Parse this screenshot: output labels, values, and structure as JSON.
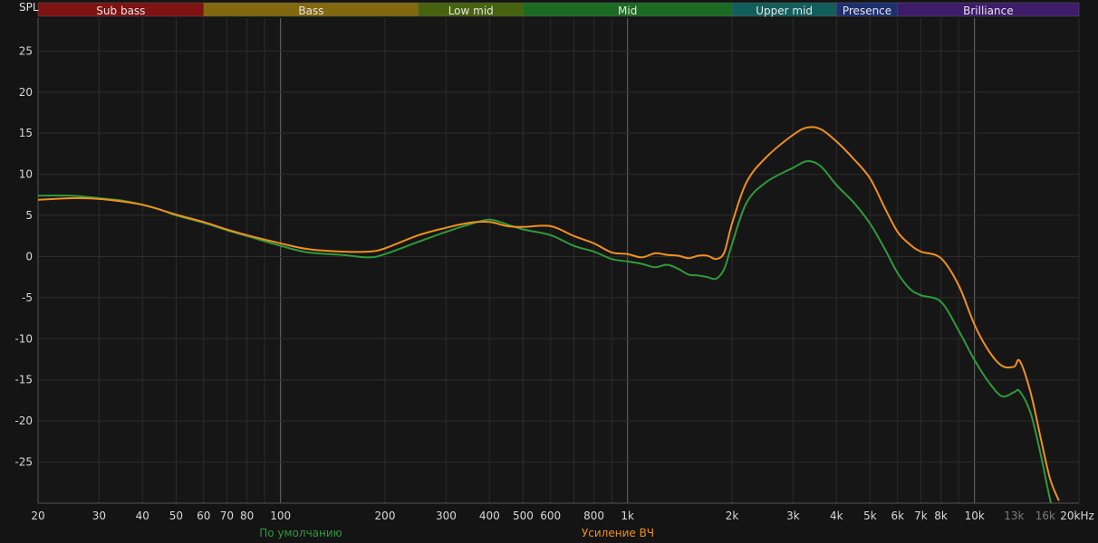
{
  "chart_data": {
    "type": "line",
    "ylabel": "SPL",
    "xunit": "Hz",
    "xscale": "log",
    "xlim": [
      20,
      20000
    ],
    "ylim": [
      -30,
      29
    ],
    "grid": true,
    "legend": "bottom",
    "bands": [
      {
        "name": "Sub bass",
        "from": 20,
        "to": 60,
        "color": "#7f1212"
      },
      {
        "name": "Bass",
        "from": 60,
        "to": 250,
        "color": "#82680e"
      },
      {
        "name": "Low mid",
        "from": 250,
        "to": 500,
        "color": "#47630f"
      },
      {
        "name": "Mid",
        "from": 500,
        "to": 2000,
        "color": "#1c6b22"
      },
      {
        "name": "Upper mid",
        "from": 2000,
        "to": 4000,
        "color": "#125e5b"
      },
      {
        "name": "Presence",
        "from": 4000,
        "to": 6000,
        "color": "#1e2f70"
      },
      {
        "name": "Brilliance",
        "from": 6000,
        "to": 20000,
        "color": "#3d1c6b"
      }
    ],
    "x_ticks": [
      {
        "v": 20,
        "label": "20"
      },
      {
        "v": 30,
        "label": "30"
      },
      {
        "v": 40,
        "label": "40"
      },
      {
        "v": 50,
        "label": "50"
      },
      {
        "v": 60,
        "label": "60"
      },
      {
        "v": 70,
        "label": "70"
      },
      {
        "v": 80,
        "label": "80"
      },
      {
        "v": 100,
        "label": "100"
      },
      {
        "v": 200,
        "label": "200"
      },
      {
        "v": 300,
        "label": "300"
      },
      {
        "v": 400,
        "label": "400"
      },
      {
        "v": 500,
        "label": "500"
      },
      {
        "v": 600,
        "label": "600"
      },
      {
        "v": 800,
        "label": "800"
      },
      {
        "v": 1000,
        "label": "1k"
      },
      {
        "v": 2000,
        "label": "2k"
      },
      {
        "v": 3000,
        "label": "3k"
      },
      {
        "v": 4000,
        "label": "4k"
      },
      {
        "v": 5000,
        "label": "5k"
      },
      {
        "v": 6000,
        "label": "6k"
      },
      {
        "v": 7000,
        "label": "7k"
      },
      {
        "v": 8000,
        "label": "8k"
      },
      {
        "v": 10000,
        "label": "10k"
      },
      {
        "v": 13000,
        "label": "13k",
        "dim": true
      },
      {
        "v": 16000,
        "label": "16k",
        "dim": true
      },
      {
        "v": 20000,
        "label": "20kHz"
      }
    ],
    "y_ticks": [
      25,
      20,
      15,
      10,
      5,
      0,
      -5,
      -10,
      -15,
      -20,
      -25
    ],
    "series": [
      {
        "name": "По умолчанию",
        "color": "#2f9a3a",
        "points": [
          [
            20,
            7.4
          ],
          [
            25,
            7.4
          ],
          [
            30,
            7.1
          ],
          [
            35,
            6.8
          ],
          [
            40,
            6.3
          ],
          [
            45,
            5.7
          ],
          [
            50,
            5.0
          ],
          [
            60,
            4.1
          ],
          [
            70,
            3.2
          ],
          [
            80,
            2.5
          ],
          [
            100,
            1.3
          ],
          [
            120,
            0.5
          ],
          [
            150,
            0.2
          ],
          [
            180,
            -0.1
          ],
          [
            200,
            0.3
          ],
          [
            250,
            1.8
          ],
          [
            300,
            3.0
          ],
          [
            350,
            3.9
          ],
          [
            400,
            4.5
          ],
          [
            450,
            3.9
          ],
          [
            500,
            3.3
          ],
          [
            600,
            2.6
          ],
          [
            700,
            1.3
          ],
          [
            800,
            0.6
          ],
          [
            900,
            -0.3
          ],
          [
            1000,
            -0.6
          ],
          [
            1100,
            -0.9
          ],
          [
            1200,
            -1.3
          ],
          [
            1300,
            -1.0
          ],
          [
            1400,
            -1.5
          ],
          [
            1500,
            -2.2
          ],
          [
            1600,
            -2.3
          ],
          [
            1700,
            -2.5
          ],
          [
            1800,
            -2.7
          ],
          [
            1900,
            -1.5
          ],
          [
            2000,
            1.5
          ],
          [
            2200,
            6.5
          ],
          [
            2500,
            9.0
          ],
          [
            3000,
            10.8
          ],
          [
            3300,
            11.6
          ],
          [
            3600,
            11.0
          ],
          [
            4000,
            8.7
          ],
          [
            4500,
            6.5
          ],
          [
            5000,
            4.0
          ],
          [
            5500,
            1.0
          ],
          [
            6000,
            -2.0
          ],
          [
            6500,
            -3.9
          ],
          [
            7000,
            -4.7
          ],
          [
            8000,
            -5.5
          ],
          [
            9000,
            -9.0
          ],
          [
            10000,
            -12.6
          ],
          [
            11000,
            -15.3
          ],
          [
            12000,
            -17.0
          ],
          [
            13000,
            -16.5
          ],
          [
            13500,
            -16.4
          ],
          [
            14500,
            -19.0
          ],
          [
            15500,
            -24.0
          ],
          [
            16500,
            -29.5
          ],
          [
            17000,
            -31.0
          ]
        ]
      },
      {
        "name": "Усиление ВЧ",
        "color": "#f0901e",
        "points": [
          [
            20,
            6.9
          ],
          [
            25,
            7.1
          ],
          [
            30,
            7.0
          ],
          [
            35,
            6.7
          ],
          [
            40,
            6.3
          ],
          [
            45,
            5.7
          ],
          [
            50,
            5.1
          ],
          [
            60,
            4.2
          ],
          [
            70,
            3.3
          ],
          [
            80,
            2.6
          ],
          [
            100,
            1.6
          ],
          [
            120,
            0.9
          ],
          [
            150,
            0.6
          ],
          [
            180,
            0.6
          ],
          [
            200,
            1.0
          ],
          [
            250,
            2.6
          ],
          [
            300,
            3.5
          ],
          [
            350,
            4.1
          ],
          [
            400,
            4.2
          ],
          [
            450,
            3.7
          ],
          [
            500,
            3.6
          ],
          [
            600,
            3.7
          ],
          [
            700,
            2.5
          ],
          [
            800,
            1.6
          ],
          [
            900,
            0.5
          ],
          [
            1000,
            0.3
          ],
          [
            1100,
            -0.1
          ],
          [
            1200,
            0.4
          ],
          [
            1300,
            0.2
          ],
          [
            1400,
            0.1
          ],
          [
            1500,
            -0.2
          ],
          [
            1600,
            0.1
          ],
          [
            1700,
            0.1
          ],
          [
            1800,
            -0.3
          ],
          [
            1900,
            0.5
          ],
          [
            2000,
            4.0
          ],
          [
            2200,
            9.0
          ],
          [
            2500,
            12.0
          ],
          [
            3000,
            14.8
          ],
          [
            3300,
            15.7
          ],
          [
            3600,
            15.5
          ],
          [
            4000,
            14.0
          ],
          [
            4500,
            11.8
          ],
          [
            5000,
            9.5
          ],
          [
            5500,
            6.0
          ],
          [
            6000,
            3.0
          ],
          [
            6500,
            1.5
          ],
          [
            7000,
            0.6
          ],
          [
            8000,
            -0.2
          ],
          [
            9000,
            -3.5
          ],
          [
            10000,
            -8.3
          ],
          [
            11000,
            -11.5
          ],
          [
            12000,
            -13.3
          ],
          [
            13000,
            -13.4
          ],
          [
            13500,
            -12.7
          ],
          [
            14500,
            -16.5
          ],
          [
            15500,
            -22.0
          ],
          [
            16500,
            -27.0
          ],
          [
            17500,
            -29.7
          ]
        ]
      }
    ]
  }
}
